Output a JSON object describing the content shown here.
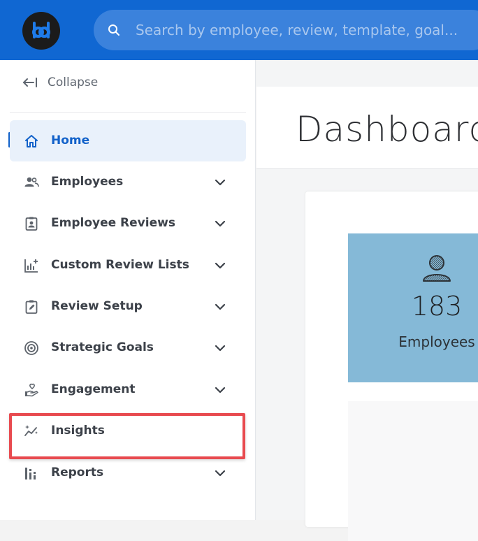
{
  "topbar": {
    "search_placeholder": "Search by employee, review, template, goal..."
  },
  "sidebar": {
    "collapse_label": "Collapse",
    "items": [
      {
        "label": "Home",
        "icon": "home-icon",
        "active": true
      },
      {
        "label": "Employees",
        "icon": "people-icon",
        "expandable": true
      },
      {
        "label": "Employee Reviews",
        "icon": "id-badge-icon",
        "expandable": true
      },
      {
        "label": "Custom Review Lists",
        "icon": "chart-plus-icon",
        "expandable": true
      },
      {
        "label": "Review Setup",
        "icon": "clipboard-edit-icon",
        "expandable": true
      },
      {
        "label": "Strategic Goals",
        "icon": "target-icon",
        "expandable": true
      },
      {
        "label": "Engagement",
        "icon": "hand-heart-icon",
        "expandable": true
      },
      {
        "label": "Insights",
        "icon": "sparkle-trend-icon",
        "highlighted": true
      },
      {
        "label": "Reports",
        "icon": "bar-chart-icon",
        "expandable": true
      }
    ]
  },
  "main": {
    "title": "Dashboard",
    "employee_tile": {
      "count": "183",
      "label": "Employees",
      "icon": "person-icon"
    }
  },
  "colors": {
    "brand_blue": "#1067d2",
    "active_blue": "#1161c9",
    "highlight_red": "#e84a4f",
    "tile_blue": "#85b9d7"
  }
}
